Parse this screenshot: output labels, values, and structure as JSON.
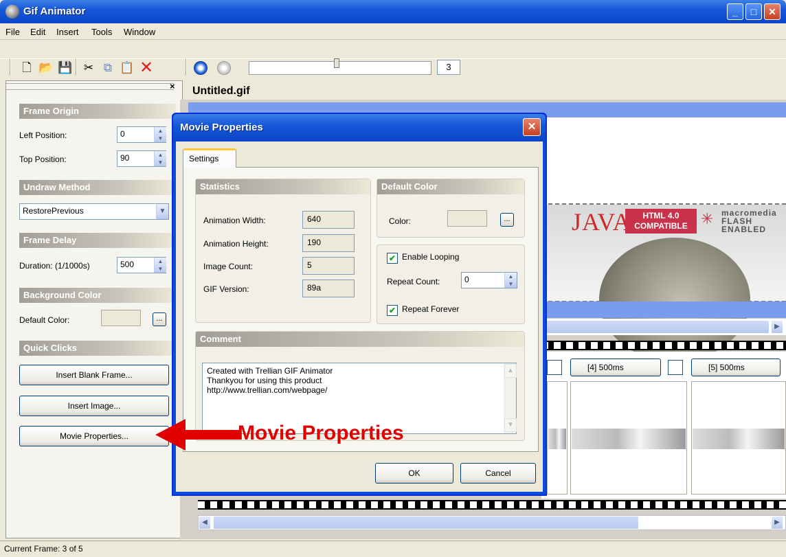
{
  "window": {
    "title": "Gif Animator",
    "minimize": "_",
    "maximize": "□",
    "close": "✕"
  },
  "menu": [
    "File",
    "Edit",
    "Insert",
    "Tools",
    "Window"
  ],
  "toolbar": {
    "frame_number": "3"
  },
  "left_panel": {
    "frame_origin": {
      "header": "Frame Origin",
      "left_label": "Left Position:",
      "left_value": "0",
      "top_label": "Top Position:",
      "top_value": "90"
    },
    "undraw": {
      "header": "Undraw Method",
      "value": "RestorePrevious"
    },
    "delay": {
      "header": "Frame Delay",
      "label": "Duration: (1/1000s)",
      "value": "500"
    },
    "background": {
      "header": "Background Color",
      "label": "Default Color:",
      "button": "..."
    },
    "quick": {
      "header": "Quick Clicks",
      "insert_blank": "Insert Blank Frame...",
      "insert_image": "Insert Image...",
      "movie_props": "Movie Properties..."
    }
  },
  "document": {
    "title": "Untitled.gif"
  },
  "banner": {
    "java": "JAVA",
    "html_badge_line1": "HTML 4.0",
    "html_badge_line2": "COMPATIBLE",
    "flash_line1": "macromedia",
    "flash_line2": "FLASH",
    "flash_line3": "ENABLED"
  },
  "frames": [
    {
      "label": "[4] 500ms"
    },
    {
      "label": "[5] 500ms"
    }
  ],
  "status": "Current Frame: 3 of 5",
  "dialog": {
    "title": "Movie Properties",
    "tab": "Settings",
    "statistics": {
      "header": "Statistics",
      "width_label": "Animation Width:",
      "width_value": "640",
      "height_label": "Animation Height:",
      "height_value": "190",
      "count_label": "Image Count:",
      "count_value": "5",
      "version_label": "GIF Version:",
      "version_value": "89a"
    },
    "default_color": {
      "header": "Default Color",
      "label": "Color:",
      "button": "..."
    },
    "looping": {
      "enable_label": "Enable Looping",
      "enable_checked": true,
      "repeat_label": "Repeat Count:",
      "repeat_value": "0",
      "forever_label": "Repeat Forever",
      "forever_checked": true
    },
    "comment": {
      "header": "Comment",
      "text": "Created with Trellian GIF Animator\nThankyou for using this product\nhttp://www.trellian.com/webpage/"
    },
    "ok": "OK",
    "cancel": "Cancel"
  },
  "annotation": {
    "text": "Movie Properties"
  }
}
